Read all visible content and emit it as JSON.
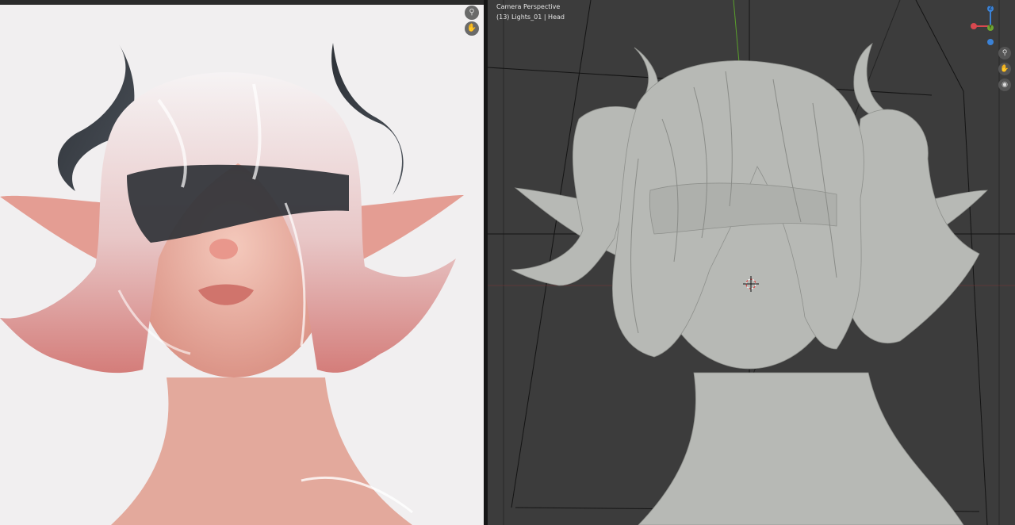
{
  "viewport": {
    "title": "Camera Perspective",
    "subtitle": "(13) Lights_01 | Head"
  },
  "gizmo": {
    "z_label": "Z",
    "y_label": "Y",
    "colors": {
      "x": "#d9484f",
      "y": "#6ea52f",
      "z": "#3b82d6",
      "neg": "#5a86c8"
    }
  },
  "icons": {
    "left_zoom": "magnifier-icon",
    "left_pan": "hand-icon",
    "vp_zoom": "magnifier-icon",
    "vp_pan": "hand-icon",
    "vp_camera": "camera-icon"
  }
}
